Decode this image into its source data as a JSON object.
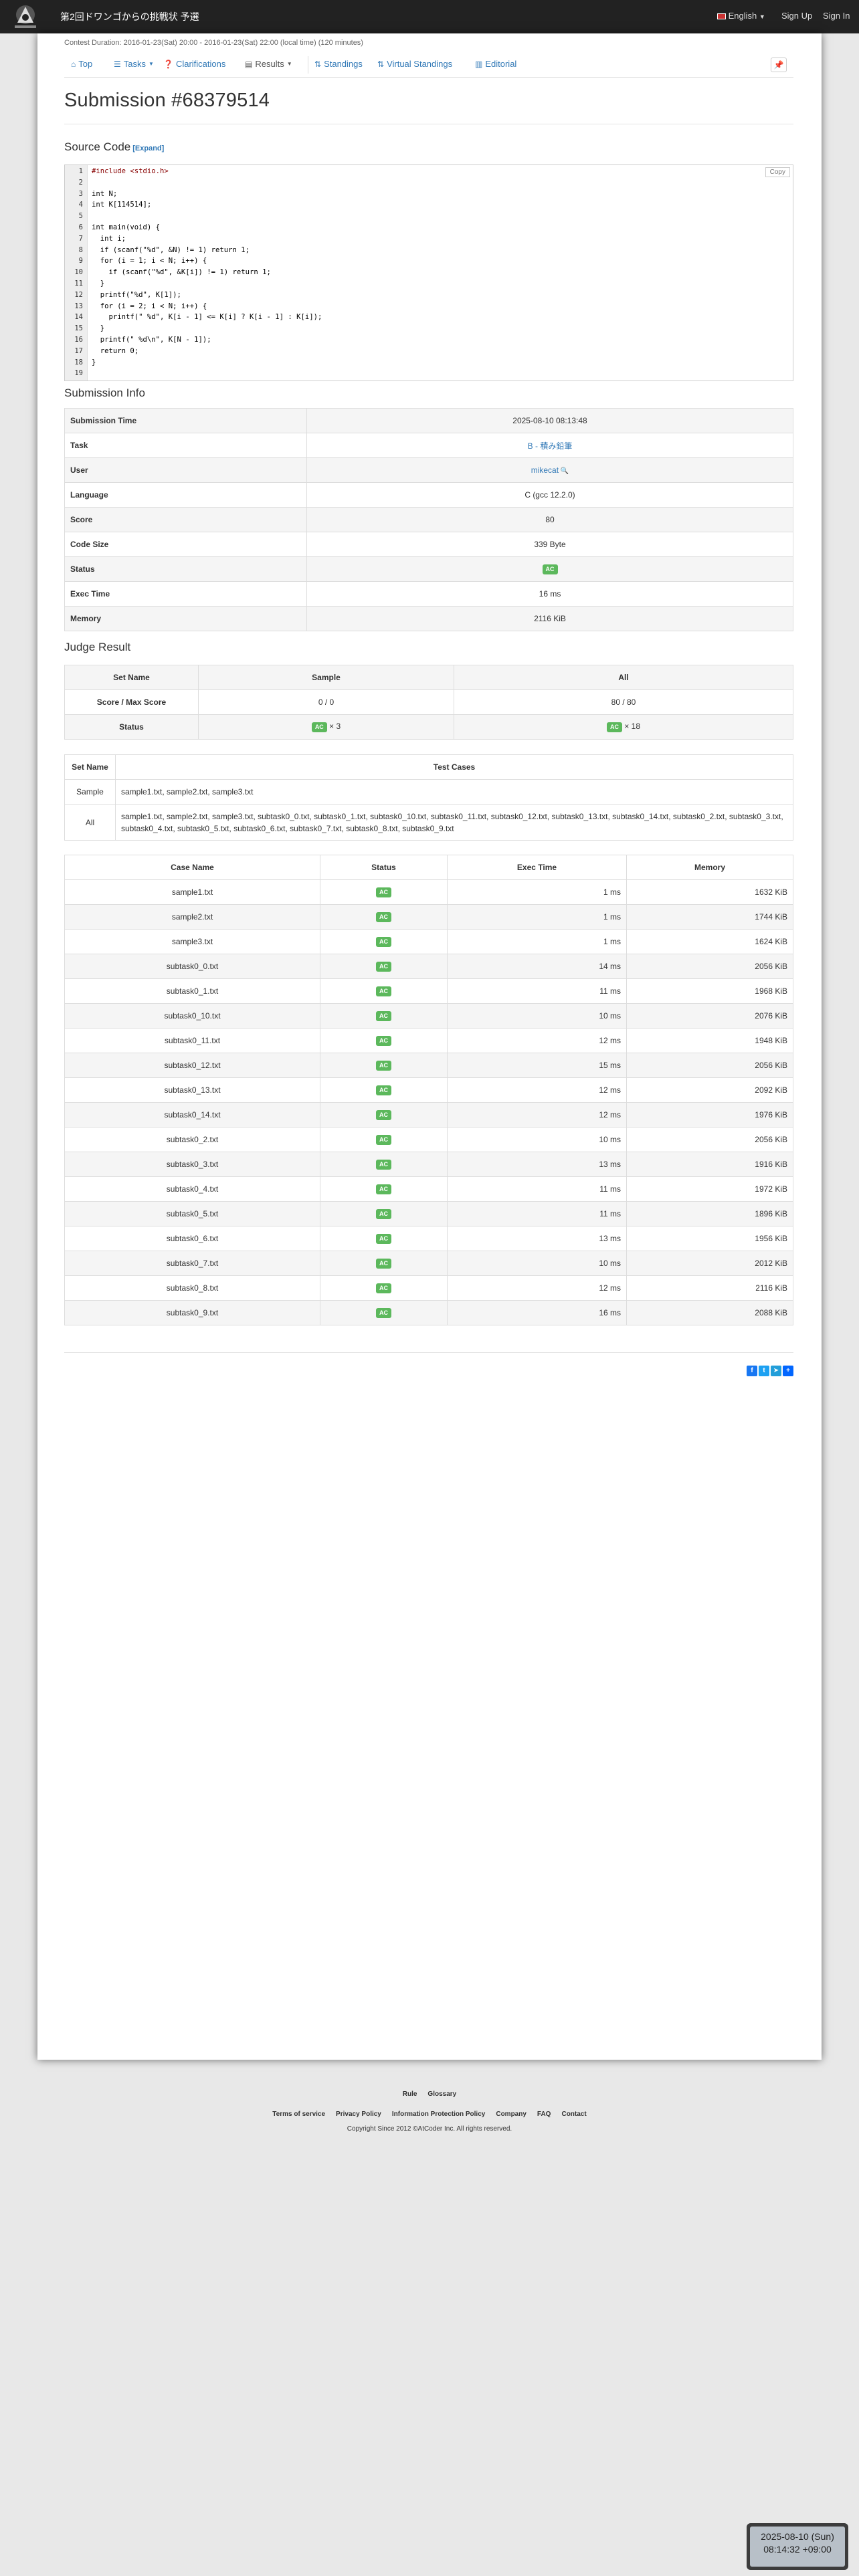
{
  "header": {
    "contest_title": "第2回ドワンゴからの挑戦状 予選",
    "language": "English",
    "sign_up": "Sign Up",
    "sign_in": "Sign In"
  },
  "contest": {
    "duration_label": "Contest Duration:",
    "duration": "2016-01-23(Sat) 20:00 - 2016-01-23(Sat) 22:00 (local time) (120 minutes)"
  },
  "tabs": [
    {
      "label": "Top",
      "icon": "home-icon"
    },
    {
      "label": "Tasks",
      "icon": "list-icon"
    },
    {
      "label": "Clarifications",
      "icon": "question-icon"
    },
    {
      "label": "Results",
      "icon": "results-icon"
    },
    {
      "label": "Standings",
      "icon": "sort-icon"
    },
    {
      "label": "Virtual Standings",
      "icon": "sort-icon"
    },
    {
      "label": "Editorial",
      "icon": "book-icon"
    }
  ],
  "page_title": "Submission #68379514",
  "source_code": {
    "heading": "Source Code",
    "expand": "[Expand]",
    "copy": "Copy",
    "lines": [
      "#include <stdio.h>",
      "",
      "int N;",
      "int K[114514];",
      "",
      "int main(void) {",
      "  int i;",
      "  if (scanf(\"%d\", &N) != 1) return 1;",
      "  for (i = 1; i < N; i++) {",
      "    if (scanf(\"%d\", &K[i]) != 1) return 1;",
      "  }",
      "  printf(\"%d\", K[1]);",
      "  for (i = 2; i < N; i++) {",
      "    printf(\" %d\", K[i - 1] <= K[i] ? K[i - 1] : K[i]);",
      "  }",
      "  printf(\" %d\\n\", K[N - 1]);",
      "  return 0;",
      "}",
      ""
    ]
  },
  "submission_info": {
    "heading": "Submission Info",
    "rows": [
      {
        "label": "Submission Time",
        "value": "2025-08-10 08:13:48"
      },
      {
        "label": "Task",
        "value": "B - 積み鉛筆"
      },
      {
        "label": "User",
        "value": "mikecat"
      },
      {
        "label": "Language",
        "value": "C (gcc 12.2.0)"
      },
      {
        "label": "Score",
        "value": "80"
      },
      {
        "label": "Code Size",
        "value": "339 Byte"
      },
      {
        "label": "Status",
        "value": "AC"
      },
      {
        "label": "Exec Time",
        "value": "16 ms"
      },
      {
        "label": "Memory",
        "value": "2116 KiB"
      }
    ]
  },
  "judge_result": {
    "heading": "Judge Result",
    "col_set_name": "Set Name",
    "col_sample": "Sample",
    "col_all": "All",
    "row_score": "Score / Max Score",
    "sample_score": "0 / 0",
    "all_score": "80 / 80",
    "row_status": "Status",
    "status_badge": "AC",
    "sample_count": "× 3",
    "all_count": "× 18"
  },
  "test_sets": {
    "col_set_name": "Set Name",
    "col_test_cases": "Test Cases",
    "rows": [
      {
        "name": "Sample",
        "cases": "sample1.txt, sample2.txt, sample3.txt"
      },
      {
        "name": "All",
        "cases": "sample1.txt, sample2.txt, sample3.txt, subtask0_0.txt, subtask0_1.txt, subtask0_10.txt, subtask0_11.txt, subtask0_12.txt, subtask0_13.txt, subtask0_14.txt, subtask0_2.txt, subtask0_3.txt, subtask0_4.txt, subtask0_5.txt, subtask0_6.txt, subtask0_7.txt, subtask0_8.txt, subtask0_9.txt"
      }
    ]
  },
  "cases": {
    "col_name": "Case Name",
    "col_status": "Status",
    "col_time": "Exec Time",
    "col_memory": "Memory",
    "rows": [
      {
        "name": "sample1.txt",
        "status": "AC",
        "time": "1 ms",
        "memory": "1632 KiB"
      },
      {
        "name": "sample2.txt",
        "status": "AC",
        "time": "1 ms",
        "memory": "1744 KiB"
      },
      {
        "name": "sample3.txt",
        "status": "AC",
        "time": "1 ms",
        "memory": "1624 KiB"
      },
      {
        "name": "subtask0_0.txt",
        "status": "AC",
        "time": "14 ms",
        "memory": "2056 KiB"
      },
      {
        "name": "subtask0_1.txt",
        "status": "AC",
        "time": "11 ms",
        "memory": "1968 KiB"
      },
      {
        "name": "subtask0_10.txt",
        "status": "AC",
        "time": "10 ms",
        "memory": "2076 KiB"
      },
      {
        "name": "subtask0_11.txt",
        "status": "AC",
        "time": "12 ms",
        "memory": "1948 KiB"
      },
      {
        "name": "subtask0_12.txt",
        "status": "AC",
        "time": "15 ms",
        "memory": "2056 KiB"
      },
      {
        "name": "subtask0_13.txt",
        "status": "AC",
        "time": "12 ms",
        "memory": "2092 KiB"
      },
      {
        "name": "subtask0_14.txt",
        "status": "AC",
        "time": "12 ms",
        "memory": "1976 KiB"
      },
      {
        "name": "subtask0_2.txt",
        "status": "AC",
        "time": "10 ms",
        "memory": "2056 KiB"
      },
      {
        "name": "subtask0_3.txt",
        "status": "AC",
        "time": "13 ms",
        "memory": "1916 KiB"
      },
      {
        "name": "subtask0_4.txt",
        "status": "AC",
        "time": "11 ms",
        "memory": "1972 KiB"
      },
      {
        "name": "subtask0_5.txt",
        "status": "AC",
        "time": "11 ms",
        "memory": "1896 KiB"
      },
      {
        "name": "subtask0_6.txt",
        "status": "AC",
        "time": "13 ms",
        "memory": "1956 KiB"
      },
      {
        "name": "subtask0_7.txt",
        "status": "AC",
        "time": "10 ms",
        "memory": "2012 KiB"
      },
      {
        "name": "subtask0_8.txt",
        "status": "AC",
        "time": "12 ms",
        "memory": "2116 KiB"
      },
      {
        "name": "subtask0_9.txt",
        "status": "AC",
        "time": "16 ms",
        "memory": "2088 KiB"
      }
    ]
  },
  "footer": {
    "links_top": [
      "Rule",
      "Glossary"
    ],
    "links_bottom": [
      "Terms of service",
      "Privacy Policy",
      "Information Protection Policy",
      "Company",
      "FAQ",
      "Contact"
    ],
    "copyright": "Copyright Since 2012 ©AtCoder Inc. All rights reserved."
  },
  "clock": {
    "date": "2025-08-10 (Sun)",
    "time": "08:14:32 +09:00"
  },
  "colors": {
    "navbar": "#222222",
    "link": "#337ab7",
    "ac_badge": "#5cb85c"
  }
}
